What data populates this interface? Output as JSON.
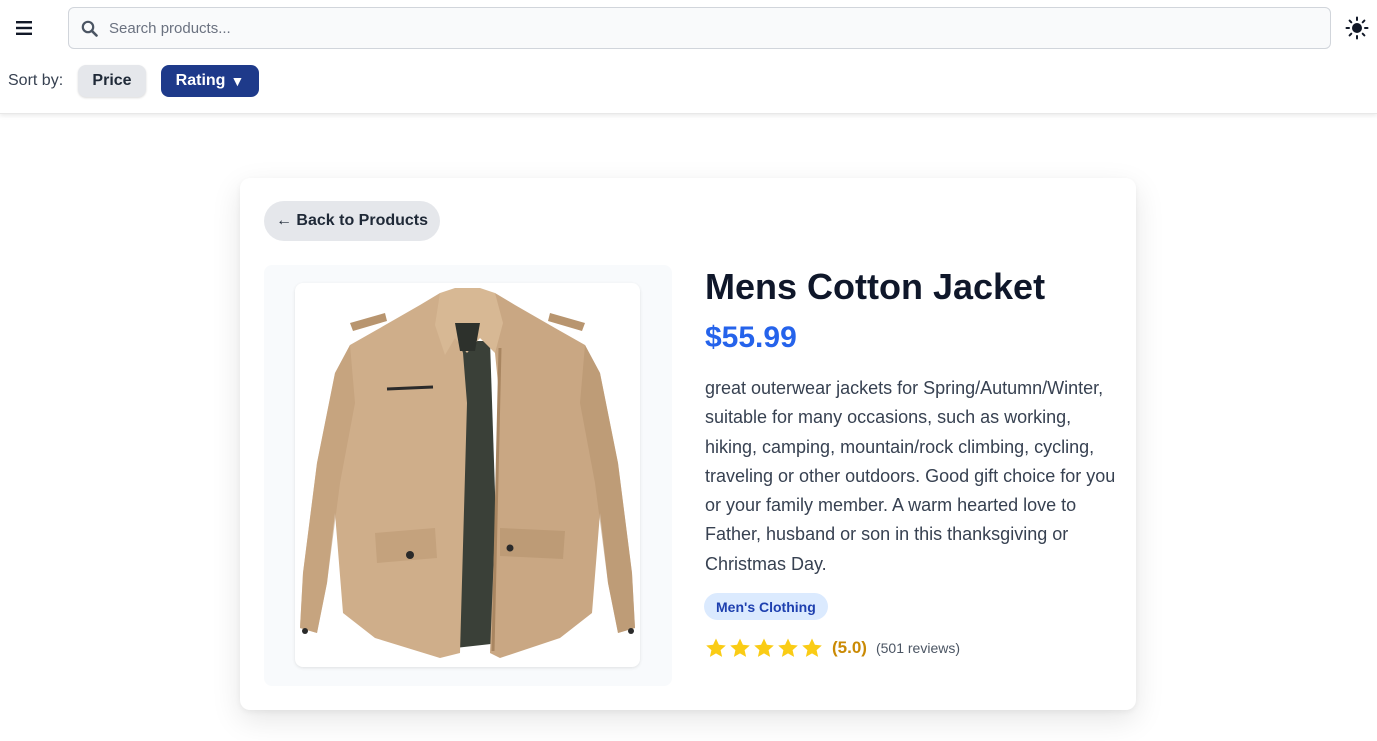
{
  "header": {
    "menu_icon": "hamburger-menu-icon",
    "search": {
      "placeholder": "Search products...",
      "value": "",
      "icon": "search-icon"
    },
    "theme_icon": "sun-icon"
  },
  "sort": {
    "label": "Sort by:",
    "options": [
      {
        "label": "Price",
        "active": false
      },
      {
        "label": "Rating",
        "active": true,
        "direction_icon": "▼"
      }
    ]
  },
  "product": {
    "back_label": "← Back to Products",
    "title": "Mens Cotton Jacket",
    "price": "$55.99",
    "description": "great outerwear jackets for Spring/Autumn/Winter, suitable for many occasions, such as working, hiking, camping, mountain/rock climbing, cycling, traveling or other outdoors. Good gift choice for you or your family member. A warm hearted love to Father, husband or son in this thanksgiving or Christmas Day.",
    "category": "Men's Clothing",
    "rating": {
      "stars": 5,
      "max_stars": 5,
      "value_label": "(5.0)",
      "reviews_label": "(501 reviews)"
    }
  },
  "colors": {
    "accent": "#2563eb",
    "active_sort": "#1e3a8a",
    "star": "#facc15",
    "rating_text": "#ca8a04",
    "badge_bg": "#dbeafe",
    "badge_text": "#1e40af"
  }
}
